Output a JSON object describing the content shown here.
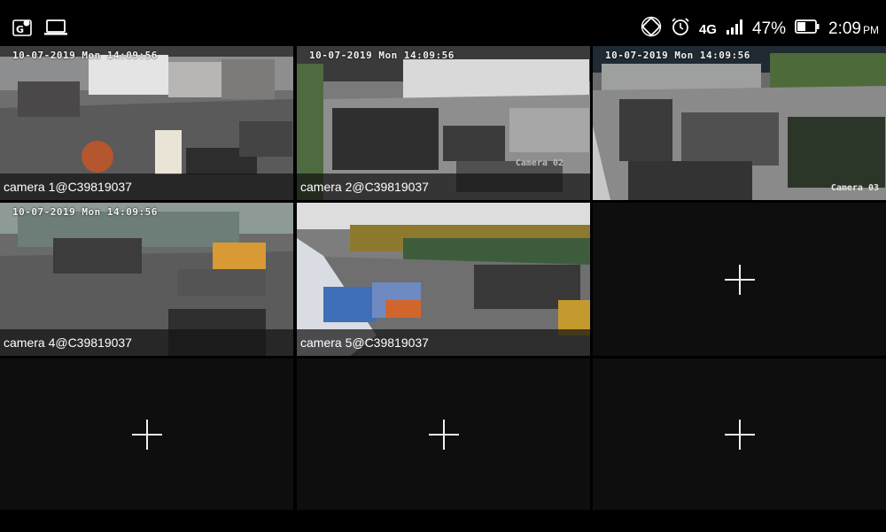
{
  "status_bar": {
    "left_icons": [
      "gps-location-icon",
      "laptop-icon"
    ],
    "right_icons": [
      "screen-rotate-icon",
      "alarm-clock-icon"
    ],
    "network": "4G",
    "battery": "47%",
    "time": "2:09",
    "ampm": "PM"
  },
  "cameras": [
    {
      "label": "camera 1@C39819037",
      "timestamp": "10-07-2019 Mon 14:09:56",
      "osd": "",
      "selected": false
    },
    {
      "label": "camera 2@C39819037",
      "timestamp": "10-07-2019 Mon 14:09:56",
      "osd": "Camera 02",
      "selected": false
    },
    {
      "label": "",
      "timestamp": "10-07-2019 Mon 14:09:56",
      "osd": "Camera 03",
      "selected": true
    },
    {
      "label": "camera 4@C39819037",
      "timestamp": "10-07-2019 Mon 14:09:56",
      "osd": "",
      "selected": false
    },
    {
      "label": "camera 5@C39819037",
      "timestamp": "",
      "osd": "",
      "selected": false
    }
  ],
  "empty_slots": [
    "add-camera",
    "add-camera",
    "add-camera",
    "add-camera"
  ],
  "colors": {
    "selected_border": "#c9474f",
    "tile_empty": "#0e0e0e"
  }
}
